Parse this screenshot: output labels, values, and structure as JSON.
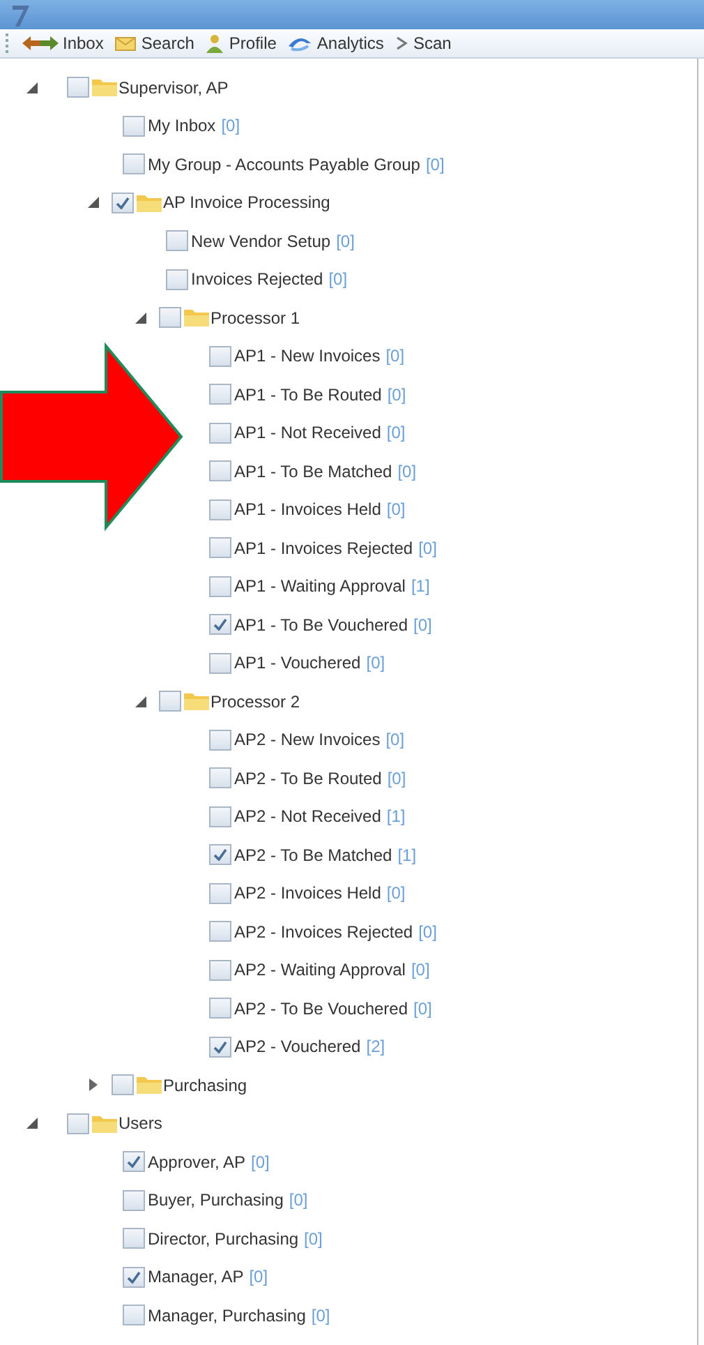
{
  "toolbar": [
    {
      "kind": "inbox",
      "label": "Inbox"
    },
    {
      "kind": "search",
      "label": "Search"
    },
    {
      "kind": "profile",
      "label": "Profile"
    },
    {
      "kind": "analytics",
      "label": "Analytics"
    },
    {
      "kind": "scan",
      "label": "Scan"
    }
  ],
  "tree": [
    {
      "label": "Supervisor, AP",
      "checked": false,
      "expanded": true,
      "children": [
        {
          "label": "My Inbox",
          "count": "[0]",
          "checked": false
        },
        {
          "label": "My Group - Accounts Payable Group",
          "count": "[0]",
          "checked": false
        },
        {
          "label": "AP Invoice Processing",
          "checked": true,
          "expanded": true,
          "children": [
            {
              "label": "New Vendor Setup",
              "count": "[0]",
              "checked": false
            },
            {
              "label": "Invoices Rejected",
              "count": "[0]",
              "checked": false
            },
            {
              "label": "Processor 1",
              "checked": false,
              "expanded": true,
              "children": [
                {
                  "label": "AP1 - New Invoices",
                  "count": "[0]",
                  "checked": false
                },
                {
                  "label": "AP1 - To Be Routed",
                  "count": "[0]",
                  "checked": false
                },
                {
                  "label": "AP1 - Not Received",
                  "count": "[0]",
                  "checked": false
                },
                {
                  "label": "AP1 - To Be Matched",
                  "count": "[0]",
                  "checked": false
                },
                {
                  "label": "AP1 - Invoices Held",
                  "count": "[0]",
                  "checked": false
                },
                {
                  "label": "AP1 - Invoices Rejected",
                  "count": "[0]",
                  "checked": false
                },
                {
                  "label": "AP1 - Waiting Approval",
                  "count": "[1]",
                  "checked": false
                },
                {
                  "label": "AP1 - To Be Vouchered",
                  "count": "[0]",
                  "checked": true
                },
                {
                  "label": "AP1 - Vouchered",
                  "count": "[0]",
                  "checked": false
                }
              ]
            },
            {
              "label": "Processor 2",
              "checked": false,
              "expanded": true,
              "children": [
                {
                  "label": "AP2 - New Invoices",
                  "count": "[0]",
                  "checked": false
                },
                {
                  "label": "AP2 - To Be Routed",
                  "count": "[0]",
                  "checked": false
                },
                {
                  "label": "AP2 - Not Received",
                  "count": "[1]",
                  "checked": false
                },
                {
                  "label": "AP2 - To Be Matched",
                  "count": "[1]",
                  "checked": true
                },
                {
                  "label": "AP2 - Invoices Held",
                  "count": "[0]",
                  "checked": false
                },
                {
                  "label": "AP2 - Invoices Rejected",
                  "count": "[0]",
                  "checked": false
                },
                {
                  "label": "AP2 - Waiting Approval",
                  "count": "[0]",
                  "checked": false
                },
                {
                  "label": "AP2 - To Be Vouchered",
                  "count": "[0]",
                  "checked": false
                },
                {
                  "label": "AP2 - Vouchered",
                  "count": "[2]",
                  "checked": true
                }
              ]
            }
          ]
        },
        {
          "label": "Purchasing",
          "checked": false,
          "expanded": false
        }
      ]
    },
    {
      "label": "Users",
      "checked": false,
      "expanded": true,
      "children": [
        {
          "label": "Approver, AP",
          "count": "[0]",
          "checked": true
        },
        {
          "label": "Buyer, Purchasing",
          "count": "[0]",
          "checked": false
        },
        {
          "label": "Director, Purchasing",
          "count": "[0]",
          "checked": false
        },
        {
          "label": "Manager, AP",
          "count": "[0]",
          "checked": true
        },
        {
          "label": "Manager, Purchasing",
          "count": "[0]",
          "checked": false
        }
      ]
    }
  ]
}
